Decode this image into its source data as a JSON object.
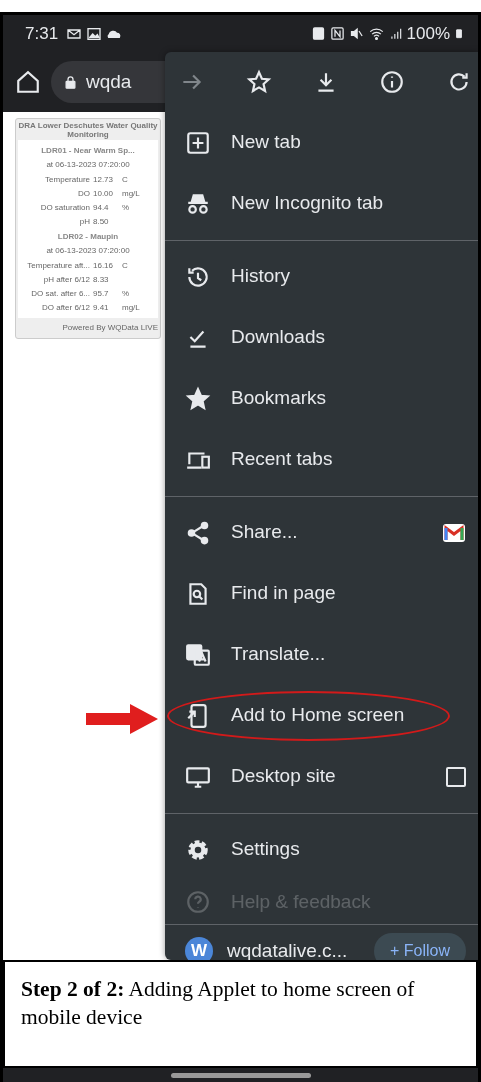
{
  "status_bar": {
    "time": "7:31",
    "battery": "100%"
  },
  "toolbar": {
    "url": "wqda"
  },
  "widget": {
    "title": "DRA Lower Deschutes Water Quality Monitoring",
    "stations": [
      {
        "name": "LDR01 - Near Warm Sp...",
        "timestamp": "at 06-13-2023 07:20:00",
        "readings": [
          {
            "label": "Temperature",
            "value": "12.73",
            "unit": "C"
          },
          {
            "label": "DO",
            "value": "10.00",
            "unit": "mg/L"
          },
          {
            "label": "DO saturation",
            "value": "94.4",
            "unit": "%"
          },
          {
            "label": "pH",
            "value": "8.50"
          }
        ]
      },
      {
        "name": "LDR02 - Maupin",
        "timestamp": "at 06-13-2023 07:20:00",
        "readings": [
          {
            "label": "Temperature aft...",
            "value": "16.16",
            "unit": "C"
          },
          {
            "label": "pH after 6/12",
            "value": "8.33"
          },
          {
            "label": "DO sat. after 6...",
            "value": "95.7",
            "unit": "%"
          },
          {
            "label": "DO after 6/12",
            "value": "9.41",
            "unit": "mg/L"
          }
        ]
      }
    ],
    "footer": "Powered By WQData LIVE"
  },
  "menu": {
    "items": [
      {
        "kind": "item",
        "label": "New tab",
        "circled": false,
        "dimmed": false
      },
      {
        "kind": "item",
        "label": "New Incognito tab",
        "circled": false,
        "dimmed": false
      },
      {
        "kind": "divider"
      },
      {
        "kind": "item",
        "label": "History",
        "circled": false,
        "dimmed": false
      },
      {
        "kind": "item",
        "label": "Downloads",
        "circled": false,
        "dimmed": false
      },
      {
        "kind": "item",
        "label": "Bookmarks",
        "circled": false,
        "dimmed": false
      },
      {
        "kind": "item",
        "label": "Recent tabs",
        "circled": false,
        "dimmed": false
      },
      {
        "kind": "divider"
      },
      {
        "kind": "share",
        "label": "Share...",
        "circled": false,
        "dimmed": false
      },
      {
        "kind": "item",
        "label": "Find in page",
        "circled": false,
        "dimmed": false
      },
      {
        "kind": "item",
        "label": "Translate...",
        "circled": false,
        "dimmed": false
      },
      {
        "kind": "item",
        "label": "Add to Home screen",
        "circled": true,
        "dimmed": false
      },
      {
        "kind": "checkbox",
        "label": "Desktop site",
        "checked": false,
        "circled": false,
        "dimmed": false
      },
      {
        "kind": "divider"
      },
      {
        "kind": "item",
        "label": "Settings",
        "circled": false,
        "dimmed": false
      },
      {
        "kind": "item",
        "label": "Help & feedback",
        "circled": false,
        "dimmed": true
      }
    ],
    "footer": {
      "avatar": "W",
      "site": "wqdatalive.c...",
      "follow": "+ Follow"
    }
  },
  "caption": {
    "text": "**Step 2 of 2:** Adding Applet to home screen of mobile device"
  }
}
